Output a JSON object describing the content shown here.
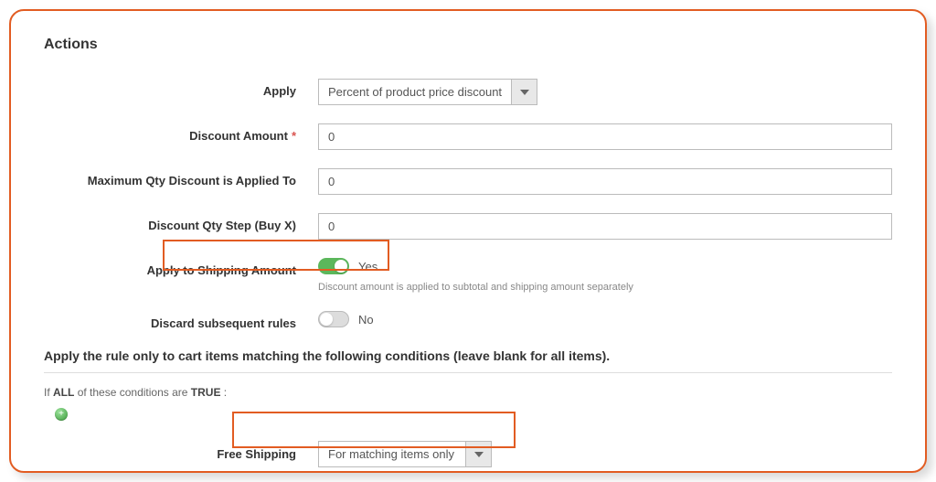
{
  "panel": {
    "title": "Actions"
  },
  "fields": {
    "apply": {
      "label": "Apply",
      "value": "Percent of product price discount"
    },
    "discount_amount": {
      "label": "Discount Amount",
      "value": "0",
      "required": true
    },
    "max_qty": {
      "label": "Maximum Qty Discount is Applied To",
      "value": "0"
    },
    "qty_step": {
      "label": "Discount Qty Step (Buy X)",
      "value": "0"
    },
    "apply_shipping": {
      "label": "Apply to Shipping Amount",
      "state": "Yes",
      "help": "Discount amount is applied to subtotal and shipping amount separately"
    },
    "discard": {
      "label": "Discard subsequent rules",
      "state": "No"
    },
    "free_shipping": {
      "label": "Free Shipping",
      "value": "For matching items only"
    }
  },
  "conditions": {
    "heading": "Apply the rule only to cart items matching the following conditions (leave blank for all items).",
    "prefix_if": "If",
    "all": "ALL",
    "middle": "of these conditions are",
    "true": "TRUE",
    "colon": ":"
  }
}
